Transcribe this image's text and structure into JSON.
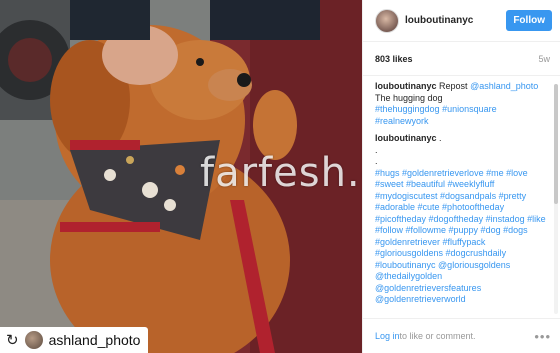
{
  "post": {
    "username": "louboutinanyc",
    "follow_label": "Follow",
    "likes": "803 likes",
    "time_ago": "5w"
  },
  "caption": {
    "user": "louboutinanyc",
    "text": "Repost",
    "mention": "@ashland_photo",
    "line2": "The hugging dog",
    "tags": [
      "#thehuggingdog",
      "#unionsquare",
      "#realnewyork"
    ]
  },
  "comment2": {
    "user": "louboutinanyc",
    "lines": [
      ".",
      ".",
      "."
    ],
    "tags": "#hugs #goldenretrieverlove #me #love #sweet #beautiful #weeklyfluff #mydogiscutest #dogsandpals #pretty #adorable #cute #photooftheday #picoftheday #dogoftheday #instadog #like #follow #followme #puppy #dog #dogs #goldenretriever #fluffypack #gloriousgoldens #dogcrushdaily #louboutinanyc @gloriousgoldens @thedailygolden @goldenretrieversfeatures @goldenretrieverworld"
  },
  "footer": {
    "login_link": "Log in",
    "login_text": " to like or comment.",
    "more": "•••"
  },
  "repost": {
    "icon": "↻",
    "name": "ashland_photo"
  },
  "watermark": "farfesh.com",
  "colors": {
    "accent": "#3897f0",
    "text": "#262626",
    "muted": "#999999"
  }
}
